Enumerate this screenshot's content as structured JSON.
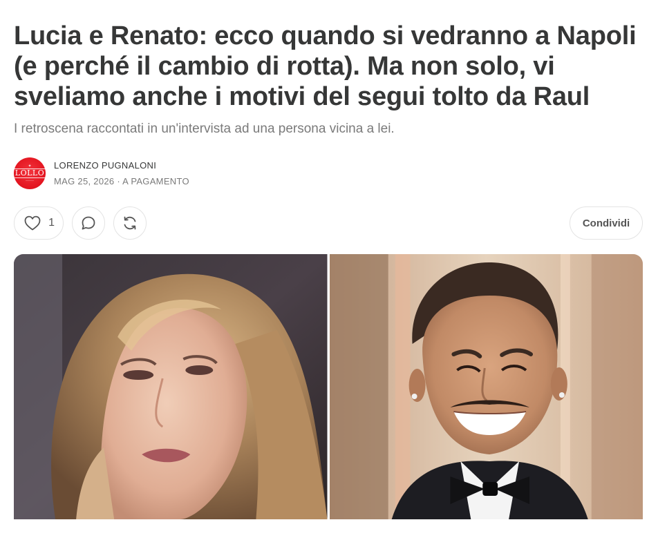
{
  "article": {
    "title": "Lucia e Renato: ecco quando si vedranno a Napoli (e perché il cambio di rotta). Ma non solo, vi sveliamo anche i motivi del segui tolto da Raul",
    "subtitle": "I retroscena raccontati in un'intervista ad una persona vicina a lei."
  },
  "byline": {
    "avatar_text": "LOLLO",
    "author": "LORENZO PUGNALONI",
    "date_line": "MAG 25, 2026 · A PAGAMENTO"
  },
  "actions": {
    "like_icon": "heart-icon",
    "like_count": "1",
    "comment_icon": "comment-icon",
    "restack_icon": "restack-icon",
    "share_label": "Condividi"
  },
  "hero": {
    "left_image": "woman-portrait",
    "right_image": "man-portrait"
  }
}
